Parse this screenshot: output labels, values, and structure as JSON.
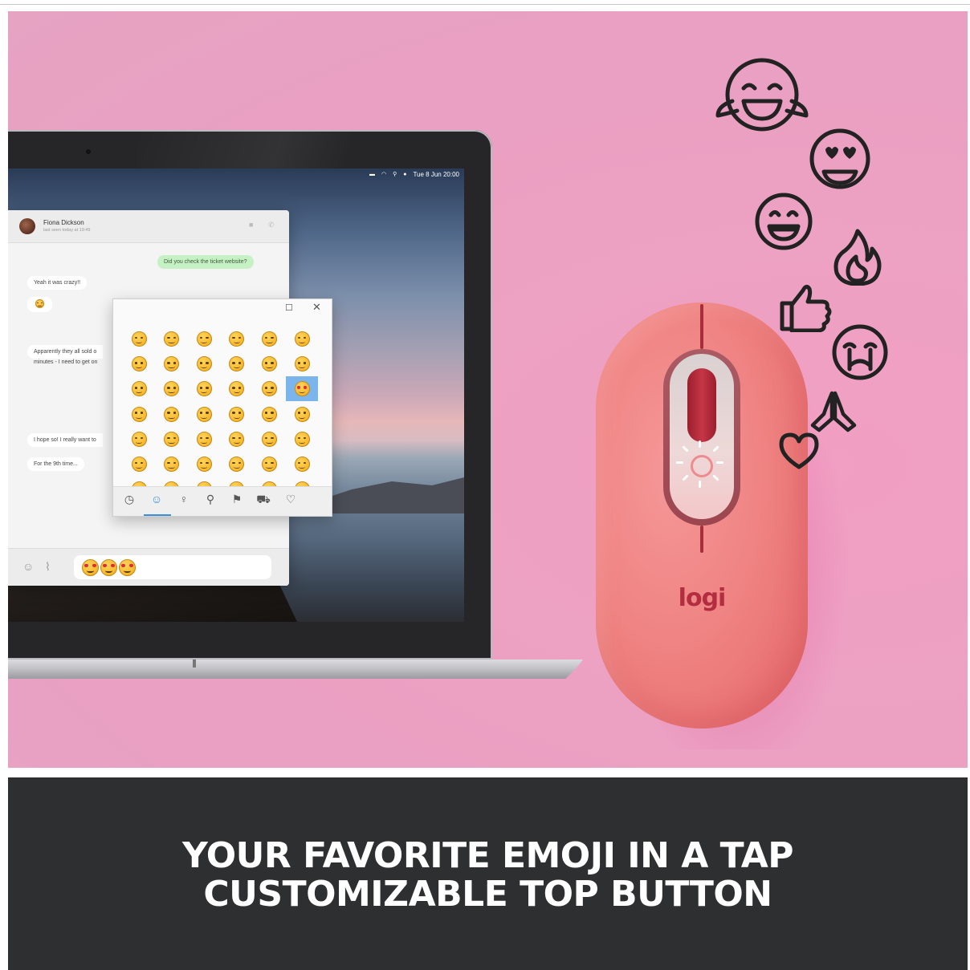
{
  "laptop": {
    "menubar": {
      "datetime": "Tue 8 Jun  20:00"
    },
    "chat": {
      "contact_name": "Fiona Dickson",
      "status": "last seen today at 19:49",
      "messages": [
        {
          "text": "Did you check the ticket website?",
          "direction": "out"
        },
        {
          "text": "Yeah it was crazy!!",
          "direction": "in"
        },
        {
          "text": "Apparently they all sold o",
          "direction": "in"
        },
        {
          "text": "minutes - I need to get on",
          "direction": "in"
        },
        {
          "text": "I hope so! I really want to",
          "direction": "in"
        },
        {
          "text": "For the 9th time...",
          "direction": "in"
        }
      ],
      "input_emojis": [
        "heart-eyes-emoji",
        "heart-eyes-emoji",
        "heart-eyes-emoji"
      ]
    },
    "emoji_picker": {
      "selected_cell": "heart-eyes-emoji",
      "tabs": [
        "recent-icon",
        "smiley-icon",
        "people-icon",
        "food-icon",
        "party-icon",
        "travel-icon",
        "heart-icon"
      ],
      "active_tab": "smiley-icon"
    }
  },
  "mouse": {
    "brand": "logi",
    "color": "#ef8282",
    "accent": "#b32d40"
  },
  "floating_icons": [
    "laughing-face-icon",
    "heart-eyes-face-icon",
    "grinning-face-icon",
    "fire-icon",
    "thumbs-up-icon",
    "crying-face-icon",
    "praying-hands-icon",
    "heart-icon"
  ],
  "caption": {
    "line1": "YOUR FAVORITE EMOJI IN A TAP",
    "line2": "CUSTOMIZABLE TOP BUTTON"
  },
  "colors": {
    "background_pink": "#e9a0c2",
    "caption_band": "#2e2f30",
    "picker_selection": "#7cb4ec"
  }
}
